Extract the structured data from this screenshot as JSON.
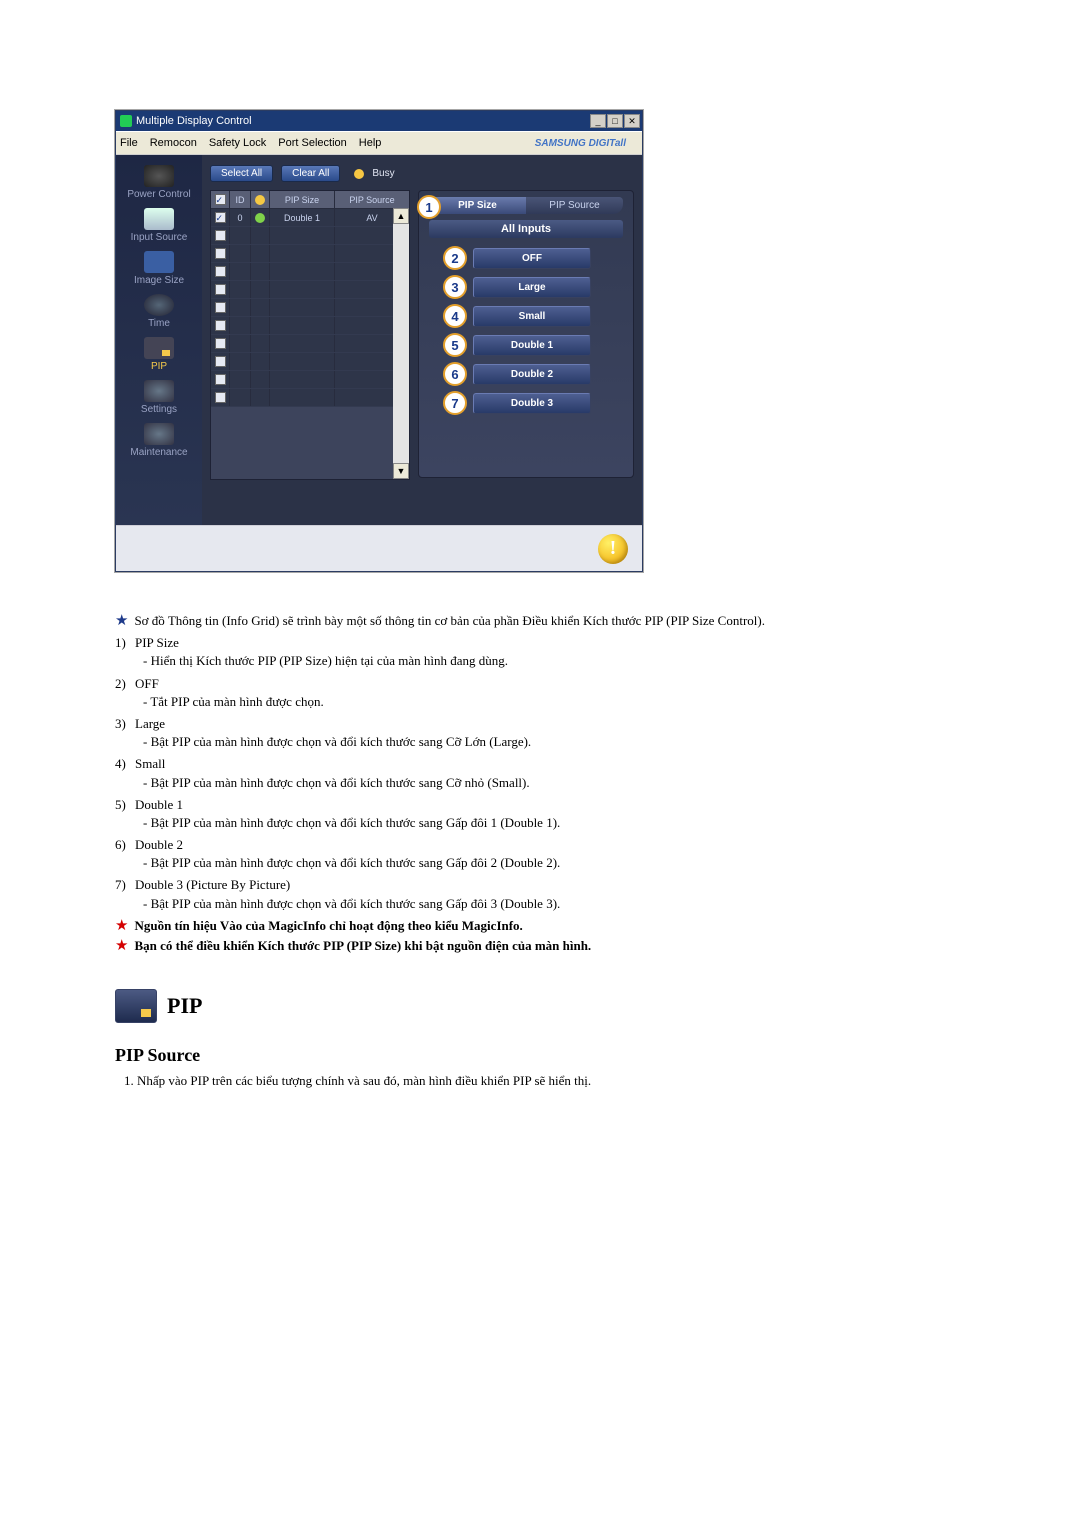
{
  "app": {
    "title": "Multiple Display Control",
    "brand": "SAMSUNG DIGITall",
    "menu": [
      "File",
      "Remocon",
      "Safety Lock",
      "Port Selection",
      "Help"
    ],
    "titlebar_buttons": [
      "min-button",
      "max-button",
      "close-button"
    ]
  },
  "sidebar": {
    "items": [
      {
        "name": "power-control",
        "label": "Power Control"
      },
      {
        "name": "input-source",
        "label": "Input Source"
      },
      {
        "name": "image-size",
        "label": "Image Size"
      },
      {
        "name": "time",
        "label": "Time"
      },
      {
        "name": "pip",
        "label": "PIP"
      },
      {
        "name": "settings",
        "label": "Settings"
      },
      {
        "name": "maintenance",
        "label": "Maintenance"
      }
    ]
  },
  "toolbar": {
    "select_all": "Select All",
    "clear_all": "Clear All",
    "busy": "Busy"
  },
  "grid": {
    "cols": {
      "chk": "✓",
      "id": "ID",
      "status": "",
      "pip_size": "PIP Size",
      "pip_source": "PIP Source"
    },
    "status_icon_color": "#7fd24a",
    "rows": [
      {
        "checked": true,
        "id": "0",
        "status": true,
        "pip_size": "Double 1",
        "pip_source": "AV"
      },
      {
        "checked": false,
        "id": "",
        "status": false,
        "pip_size": "",
        "pip_source": ""
      },
      {
        "checked": false,
        "id": "",
        "status": false,
        "pip_size": "",
        "pip_source": ""
      },
      {
        "checked": false,
        "id": "",
        "status": false,
        "pip_size": "",
        "pip_source": ""
      },
      {
        "checked": false,
        "id": "",
        "status": false,
        "pip_size": "",
        "pip_source": ""
      },
      {
        "checked": false,
        "id": "",
        "status": false,
        "pip_size": "",
        "pip_source": ""
      },
      {
        "checked": false,
        "id": "",
        "status": false,
        "pip_size": "",
        "pip_source": ""
      },
      {
        "checked": false,
        "id": "",
        "status": false,
        "pip_size": "",
        "pip_source": ""
      },
      {
        "checked": false,
        "id": "",
        "status": false,
        "pip_size": "",
        "pip_source": ""
      },
      {
        "checked": false,
        "id": "",
        "status": false,
        "pip_size": "",
        "pip_source": ""
      },
      {
        "checked": false,
        "id": "",
        "status": false,
        "pip_size": "",
        "pip_source": ""
      }
    ]
  },
  "right": {
    "tabs": {
      "left": "PIP Size",
      "right": "PIP Source"
    },
    "callout_1": "1",
    "all_inputs": "All Inputs",
    "options": [
      {
        "n": "2",
        "label": "OFF"
      },
      {
        "n": "3",
        "label": "Large"
      },
      {
        "n": "4",
        "label": "Small"
      },
      {
        "n": "5",
        "label": "Double 1"
      },
      {
        "n": "6",
        "label": "Double 2"
      },
      {
        "n": "7",
        "label": "Double 3"
      }
    ]
  },
  "doc": {
    "star_intro": "Sơ đồ Thông tin (Info Grid) sẽ trình bày một số thông tin cơ bản của phần Điều khiển Kích thước PIP (PIP Size Control).",
    "list": [
      {
        "n": "1)",
        "title": "PIP Size",
        "sub": "- Hiển thị Kích thước PIP (PIP Size) hiện tại của màn hình đang dùng."
      },
      {
        "n": "2)",
        "title": "OFF",
        "sub": "- Tắt PIP của màn hình được chọn."
      },
      {
        "n": "3)",
        "title": "Large",
        "sub": "- Bật PIP của màn hình được chọn và đổi kích thước sang Cỡ Lớn (Large)."
      },
      {
        "n": "4)",
        "title": "Small",
        "sub": "- Bật PIP của màn hình được chọn và đổi kích thước sang Cỡ nhỏ (Small)."
      },
      {
        "n": "5)",
        "title": "Double 1",
        "sub": "- Bật PIP của màn hình được chọn và đổi kích thước sang Gấp đôi 1 (Double 1)."
      },
      {
        "n": "6)",
        "title": "Double 2",
        "sub": "- Bật PIP của màn hình được chọn và đổi kích thước sang Gấp đôi 2 (Double 2)."
      },
      {
        "n": "7)",
        "title": "Double 3 (Picture By Picture)",
        "sub": "- Bật PIP của màn hình được chọn và đổi kích thước sang Gấp đôi 3 (Double 3)."
      }
    ],
    "note1": "Nguồn tín hiệu Vào của MagicInfo chỉ hoạt động theo kiểu MagicInfo.",
    "note2": "Bạn có thể điều khiển Kích thước PIP (PIP Size) khi bật nguồn điện của màn hình.",
    "pip_label": "PIP",
    "pip_source_heading": "PIP Source",
    "pip_source_step": "Nhấp vào PIP trên các biểu tượng chính và sau đó, màn hình điều khiển PIP sẽ hiển thị."
  }
}
